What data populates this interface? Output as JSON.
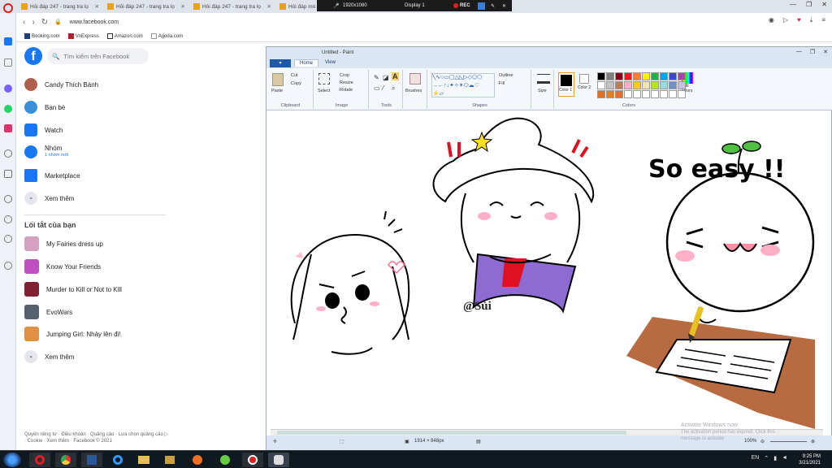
{
  "browser": {
    "tabs": [
      {
        "label": "Hỏi đáp 247 - trang tra lọ"
      },
      {
        "label": "Hỏi đáp 247 - trang tra lọ"
      },
      {
        "label": "Hỏi đáp 247 - trang tra lọ"
      },
      {
        "label": "Hỏi đáp mó"
      }
    ],
    "url": "www.facebook.com",
    "bookmarks": [
      "Booking.com",
      "VnExpress",
      "Amazon.com",
      "Agoda.com"
    ],
    "recorder": {
      "resolution": "1920x1080",
      "display": "Display 1",
      "rec": "REC"
    }
  },
  "facebook": {
    "search_placeholder": "Tìm kiếm trên Facebook",
    "menu": [
      {
        "label": "Candy Thích Bánh"
      },
      {
        "label": "Bạn bè"
      },
      {
        "label": "Watch"
      },
      {
        "label": "Nhóm",
        "sub": "1 nhóm mới"
      },
      {
        "label": "Marketplace"
      },
      {
        "label": "Xem thêm"
      }
    ],
    "shortcuts_title": "Lối tắt của bạn",
    "shortcuts": [
      {
        "label": "My Fairies dress up"
      },
      {
        "label": "Know Your Friends"
      },
      {
        "label": "Murder to Kill or Not to Kill"
      },
      {
        "label": "EvoWars"
      },
      {
        "label": "Jumping Girl: Nhảy lên đi!"
      },
      {
        "label": "Xem thêm"
      }
    ],
    "footer": "Quyền riêng tư · Điều khoản · Quảng cáo · Lựa chọn quảng cáo ▷ · Cookie · Xem thêm · Facebook © 2021"
  },
  "paint": {
    "title": "Untitled - Paint",
    "tabs": {
      "home": "Home",
      "view": "View"
    },
    "groups": {
      "clipboard": "Clipboard",
      "image": "Image",
      "tools": "Tools",
      "shapes": "Shapes",
      "colors": "Colors"
    },
    "buttons": {
      "paste": "Paste",
      "cut": "Cut",
      "copy": "Copy",
      "select": "Select",
      "crop": "Crop",
      "resize": "Resize",
      "rotate": "Rotate",
      "brushes": "Brushes",
      "outline": "Outline",
      "fill": "Fill",
      "size": "Size",
      "color1": "Color 1",
      "color2": "Color 2",
      "edit_colors": "Edit colors"
    },
    "palette": [
      "#000000",
      "#7f7f7f",
      "#880015",
      "#ed1c24",
      "#ff7f27",
      "#fff200",
      "#22b14c",
      "#00a2e8",
      "#3f48cc",
      "#a349a4",
      "#ffffff",
      "#c3c3c3",
      "#b97a57",
      "#ffaec9",
      "#ffc90e",
      "#efe4b0",
      "#b5e61d",
      "#99d9ea",
      "#7092be",
      "#c8bfe7",
      "#e07020",
      "#e08020",
      "#e07030",
      "#ffffff",
      "#ffffff",
      "#ffffff",
      "#ffffff",
      "#ffffff",
      "#ffffff",
      "#ffffff"
    ],
    "canvas": {
      "signature": "@Sủi",
      "caption": "So easy !!"
    },
    "status_size": "1914 × 848px",
    "zoom": "100%"
  },
  "watermark": {
    "title": "Activate Windows now",
    "body": "The activation period has expired. Click this message to activate"
  },
  "taskbar": {
    "time": "9:25 PM",
    "date": "3/21/2021",
    "lang": "EN"
  }
}
